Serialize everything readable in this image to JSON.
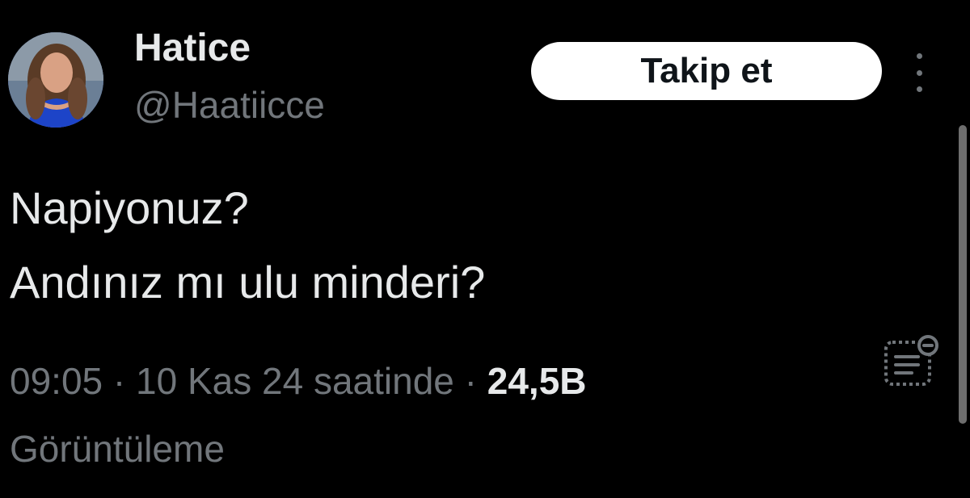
{
  "user": {
    "display_name": "Hatice",
    "handle": "@Haatiicce"
  },
  "actions": {
    "follow_label": "Takip et",
    "more_icon": "more-vertical-icon",
    "analytics_icon": "analytics-icon"
  },
  "tweet": {
    "lines": [
      "Napiyonuz?",
      "Andınız mı ulu minderi?"
    ]
  },
  "meta": {
    "time": "09:05",
    "separator": " · ",
    "date_text": "10 Kas 24 saatinde",
    "views_count": "24,5B",
    "views_label": "Görüntüleme"
  },
  "colors": {
    "background": "#000000",
    "primary_text": "#e7e9ea",
    "secondary_text": "#71767b",
    "button_bg": "#ffffff",
    "button_text": "#0f1419"
  }
}
